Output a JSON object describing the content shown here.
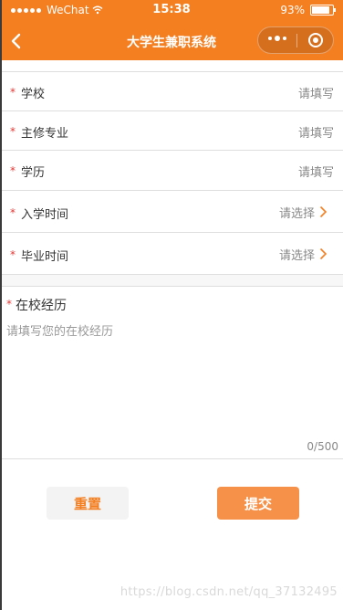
{
  "statusbar": {
    "carrier": "WeChat",
    "time": "15:38",
    "battery": "93%",
    "battery_level": 0.93
  },
  "navbar": {
    "title": "大学生兼职系统"
  },
  "form": {
    "rows": [
      {
        "label": "学校",
        "value": "请填写"
      },
      {
        "label": "主修专业",
        "value": "请填写"
      },
      {
        "label": "学历",
        "value": "请填写"
      },
      {
        "label": "入学时间",
        "value": "请选择"
      },
      {
        "label": "毕业时间",
        "value": "请选择"
      }
    ],
    "required_mark": "*",
    "experience": {
      "label": "在校经历",
      "placeholder": "请填写您的在校经历",
      "counter": "0/500"
    }
  },
  "buttons": {
    "reset": "重置",
    "submit": "提交"
  },
  "watermark": "https://blog.csdn.net/qq_37132495",
  "colors": {
    "accent": "#f47f21",
    "required": "#e53935"
  }
}
